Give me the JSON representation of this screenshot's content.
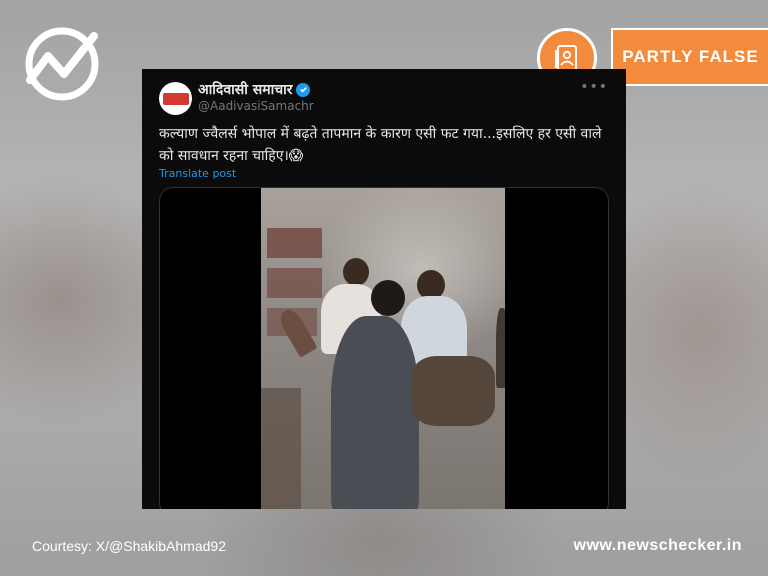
{
  "brand": {
    "logo_icon": "newschecker-chart-icon",
    "site_url": "www.newschecker.in"
  },
  "verdict": {
    "icon": "document-person-icon",
    "label": "PARTLY FALSE",
    "color": "#f28c3c"
  },
  "tweet": {
    "display_name": "आदिवासी समाचार",
    "verified": true,
    "handle": "@AadivasiSamachr",
    "more_icon": "more-horizontal-icon",
    "text": "कल्याण ज्वैलर्स भोपाल में बढ़ते तापमान के कारण एसी फट गया...इसलिए हर एसी वाले को सावधान रहना चाहिए।😱",
    "translate_label": "Translate post",
    "media_type": "video"
  },
  "footer": {
    "courtesy": "Courtesy: X/@ShakibAhmad92"
  }
}
